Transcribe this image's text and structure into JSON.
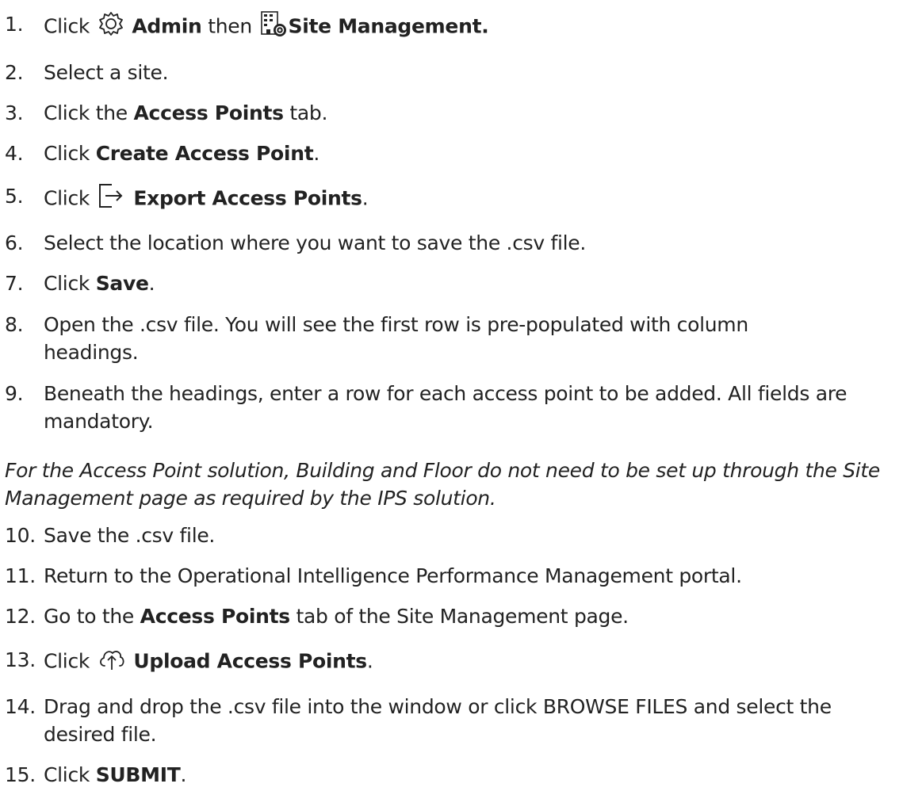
{
  "steps": [
    {
      "num": "1.",
      "pre": "Click ",
      "icon1": "gear-icon",
      "b1": "Admin",
      "mid": " then ",
      "icon2": "building-gear-icon",
      "b2": "Site Management."
    },
    {
      "num": "2.",
      "text": "Select a site."
    },
    {
      "num": "3.",
      "pre": "Click the ",
      "b1": "Access Points",
      "post": " tab."
    },
    {
      "num": "4.",
      "pre": "Click ",
      "b1": "Create Access Point",
      "post": "."
    },
    {
      "num": "5.",
      "pre": "Click ",
      "icon1": "export-icon",
      "b1": "Export Access Points",
      "post": "."
    },
    {
      "num": "6.",
      "text": "Select the location where you want to save the .csv file."
    },
    {
      "num": "7.",
      "pre": "Click ",
      "b1": "Save",
      "post": "."
    },
    {
      "num": "8.",
      "text": "Open the .csv file. You will see the first row is pre-populated with column headings."
    },
    {
      "num": "9.",
      "text": "Beneath the headings, enter a row for each access point to be added. All fields are mandatory."
    },
    {
      "num": "10.",
      "text": "Save the .csv file."
    },
    {
      "num": "11.",
      "text": "Return to the Operational Intelligence Performance Management portal."
    },
    {
      "num": "12.",
      "pre": "Go to the ",
      "b1": "Access Points",
      "post": " tab of the Site Management page."
    },
    {
      "num": "13.",
      "pre": "Click ",
      "icon1": "cloud-upload-icon",
      "b1": "Upload Access Points",
      "post": "."
    },
    {
      "num": "14.",
      "text": "Drag and drop the .csv file into the window or click BROWSE FILES and select the desired file."
    },
    {
      "num": "15.",
      "pre": "Click ",
      "b1": "SUBMIT",
      "post": "."
    }
  ],
  "note": "For the Access Point solution, Building and Floor do not need to be set up through the Site Management page as required by the IPS solution."
}
